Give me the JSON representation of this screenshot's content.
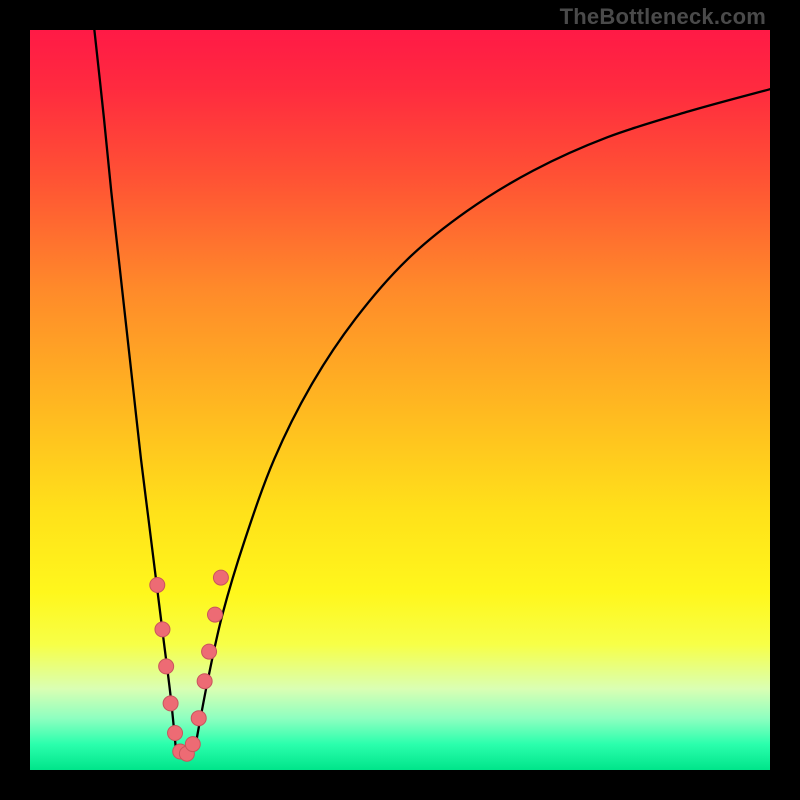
{
  "watermark": "TheBottleneck.com",
  "colors": {
    "gradient_stops": [
      {
        "offset": 0.0,
        "color": "#ff1a46"
      },
      {
        "offset": 0.08,
        "color": "#ff2b3f"
      },
      {
        "offset": 0.2,
        "color": "#ff5234"
      },
      {
        "offset": 0.35,
        "color": "#ff8a2a"
      },
      {
        "offset": 0.5,
        "color": "#ffb521"
      },
      {
        "offset": 0.65,
        "color": "#ffe11a"
      },
      {
        "offset": 0.76,
        "color": "#fff71c"
      },
      {
        "offset": 0.83,
        "color": "#f7ff47"
      },
      {
        "offset": 0.89,
        "color": "#daffb3"
      },
      {
        "offset": 0.93,
        "color": "#8effc0"
      },
      {
        "offset": 0.965,
        "color": "#2bffad"
      },
      {
        "offset": 1.0,
        "color": "#00e58a"
      }
    ],
    "curve": "#000000",
    "marker_fill": "#ed6b74",
    "marker_stroke": "#c9545d"
  },
  "chart_data": {
    "type": "line",
    "title": "",
    "xlabel": "",
    "ylabel": "",
    "xlim": [
      0,
      100
    ],
    "ylim": [
      0,
      100
    ],
    "series": [
      {
        "name": "bottleneck-curve-left",
        "x": [
          8.7,
          10,
          11,
          12,
          13,
          14,
          15,
          16,
          17,
          18,
          19,
          19.7
        ],
        "y": [
          100,
          88,
          78,
          69,
          60,
          51,
          42,
          34,
          26,
          18,
          10,
          3
        ]
      },
      {
        "name": "bottleneck-curve-right",
        "x": [
          22.3,
          24,
          26,
          29,
          33,
          38,
          44,
          51,
          59,
          68,
          78,
          89,
          100
        ],
        "y": [
          3,
          12,
          21,
          31,
          42,
          52,
          61,
          69,
          75.5,
          81,
          85.5,
          89,
          92
        ]
      }
    ],
    "markers": {
      "name": "highlight-points",
      "points": [
        {
          "x": 17.2,
          "y": 25
        },
        {
          "x": 17.9,
          "y": 19
        },
        {
          "x": 18.4,
          "y": 14
        },
        {
          "x": 19.0,
          "y": 9
        },
        {
          "x": 19.6,
          "y": 5
        },
        {
          "x": 20.3,
          "y": 2.5
        },
        {
          "x": 21.2,
          "y": 2.2
        },
        {
          "x": 22.0,
          "y": 3.5
        },
        {
          "x": 22.8,
          "y": 7
        },
        {
          "x": 23.6,
          "y": 12
        },
        {
          "x": 24.2,
          "y": 16
        },
        {
          "x": 25.0,
          "y": 21
        },
        {
          "x": 25.8,
          "y": 26
        }
      ]
    },
    "curve_valley_x": 21,
    "annotations": []
  }
}
